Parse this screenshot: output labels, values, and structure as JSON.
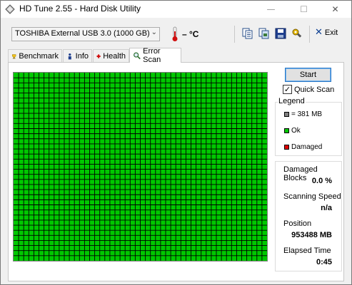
{
  "window": {
    "title": "HD Tune 2.55 - Hard Disk Utility",
    "minimize_glyph": "—",
    "maximize_glyph": "☐",
    "close_glyph": "✕"
  },
  "toolbar": {
    "drive": "TOSHIBA External USB 3.0 (1000 GB)",
    "temperature": "– °C",
    "icons": [
      "copy-info-icon",
      "copy-screenshot-icon",
      "save-icon",
      "options-icon"
    ],
    "exit_label": "Exit"
  },
  "tabs": [
    {
      "label": "Benchmark",
      "icon": "benchmark-icon",
      "active": false
    },
    {
      "label": "Info",
      "icon": "info-icon",
      "active": false
    },
    {
      "label": "Health",
      "icon": "health-icon",
      "active": false
    },
    {
      "label": "Error Scan",
      "icon": "magnifier-icon",
      "active": true
    }
  ],
  "error_scan": {
    "start_label": "Start",
    "quick_scan_label": "Quick Scan",
    "quick_scan_checked": true,
    "legend": {
      "title": "Legend",
      "items": [
        {
          "label": "= 381 MB",
          "color": "#808080"
        },
        {
          "label": "Ok",
          "color": "#00c800"
        },
        {
          "label": "Damaged",
          "color": "#e00000"
        }
      ]
    },
    "stats": {
      "damaged_blocks_label": "Damaged Blocks",
      "damaged_blocks_value": "0.0",
      "damaged_blocks_unit": "%",
      "scanning_speed_label": "Scanning Speed",
      "scanning_speed_value": "n/a",
      "position_label": "Position",
      "position_value": "953488 MB",
      "elapsed_label": "Elapsed Time",
      "elapsed_value": "0:45"
    },
    "block_grid": {
      "status": "all ok",
      "ok_color": "#00c800",
      "line_color": "#000000"
    }
  }
}
